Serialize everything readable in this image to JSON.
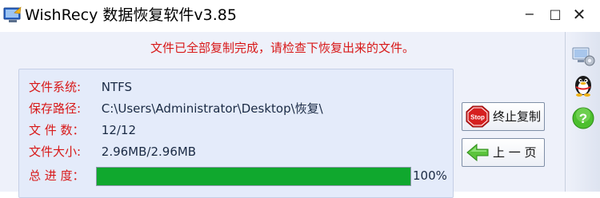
{
  "window": {
    "title": "WishRecy 数据恢复软件v3.85",
    "minimize_glyph": "−",
    "maximize_glyph": "□",
    "close_glyph": "✕"
  },
  "message": "文件已全部复制完成，请检查下恢复出来的文件。",
  "info": {
    "rows": [
      {
        "label": "文件系统:",
        "value": "NTFS"
      },
      {
        "label": "保存路径:",
        "value": "C:\\Users\\Administrator\\Desktop\\恢复\\"
      },
      {
        "label": "文 件 数：",
        "value": "12/12"
      },
      {
        "label": "文件大小:",
        "value": "2.96MB/2.96MB"
      }
    ],
    "progress": {
      "label": "总 进 度：",
      "fraction": 1.0,
      "percent_text": "100%"
    }
  },
  "buttons": {
    "stop": {
      "label": "终止复制",
      "icon": "stop-sign-icon",
      "icon_text": "Stop"
    },
    "prev": {
      "label": "上 一 页",
      "icon": "green-left-arrow-icon"
    }
  },
  "sidebar": {
    "icons": [
      "computer-gear-icon",
      "qq-penguin-icon",
      "help-question-icon"
    ]
  },
  "colors": {
    "message_red": "#d81818",
    "progress_green": "#10a82e",
    "panel_bg": "#e4ebfa"
  }
}
